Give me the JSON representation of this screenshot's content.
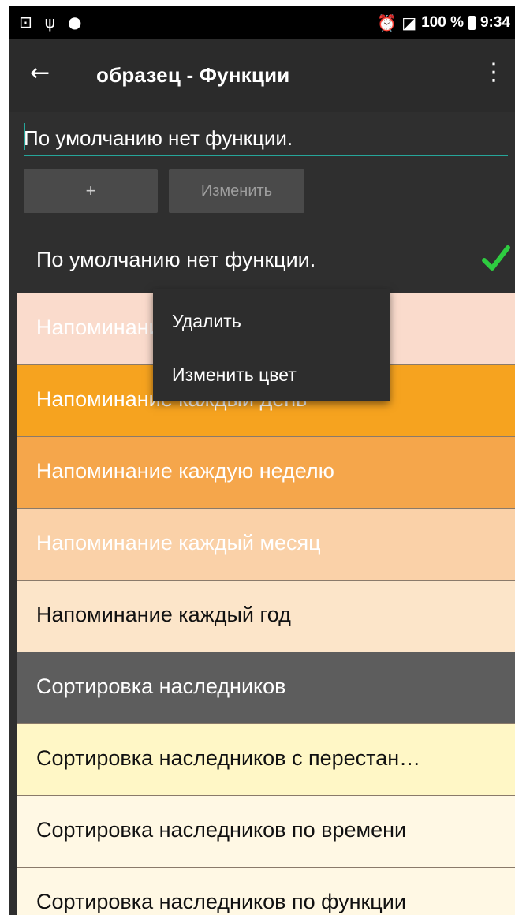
{
  "status_bar": {
    "left_icons": [
      "image-icon",
      "usb-icon",
      "circle-icon"
    ],
    "right_text": "100 %",
    "time": "9:34"
  },
  "toolbar": {
    "title": "образец - Функции"
  },
  "input": {
    "value": "По умолчанию нет функции."
  },
  "buttons": {
    "add": "+",
    "edit": "Изменить"
  },
  "default_item": {
    "label": "По умолчанию нет функции."
  },
  "list": [
    {
      "label": "Напоминание",
      "bg": "#fadbcc",
      "fg": "#ffffff"
    },
    {
      "label": "Напоминание каждый день",
      "bg": "#f6a31f",
      "fg": "#ffffff"
    },
    {
      "label": "Напоминание каждую неделю",
      "bg": "#f5a64b",
      "fg": "#ffffff"
    },
    {
      "label": "Напоминание каждый месяц",
      "bg": "#fad1a8",
      "fg": "#ffffff"
    },
    {
      "label": "Напоминание каждый год",
      "bg": "#fce5c9",
      "fg": "#111111"
    },
    {
      "label": "Сортировка наследников",
      "bg": "#5d5d5d",
      "fg": "#ffffff"
    },
    {
      "label": "Сортировка наследников с перестан…",
      "bg": "#fff7c6",
      "fg": "#111111"
    },
    {
      "label": "Сортировка наследников по времени",
      "bg": "#fff8e4",
      "fg": "#111111"
    },
    {
      "label": "Сортировка наследников по функции",
      "bg": "#fff8e4",
      "fg": "#111111"
    }
  ],
  "context_menu": {
    "items": [
      "Удалить",
      "Изменить цвет"
    ]
  },
  "colors": {
    "accent": "#26a69a",
    "check": "#2ecc40"
  }
}
